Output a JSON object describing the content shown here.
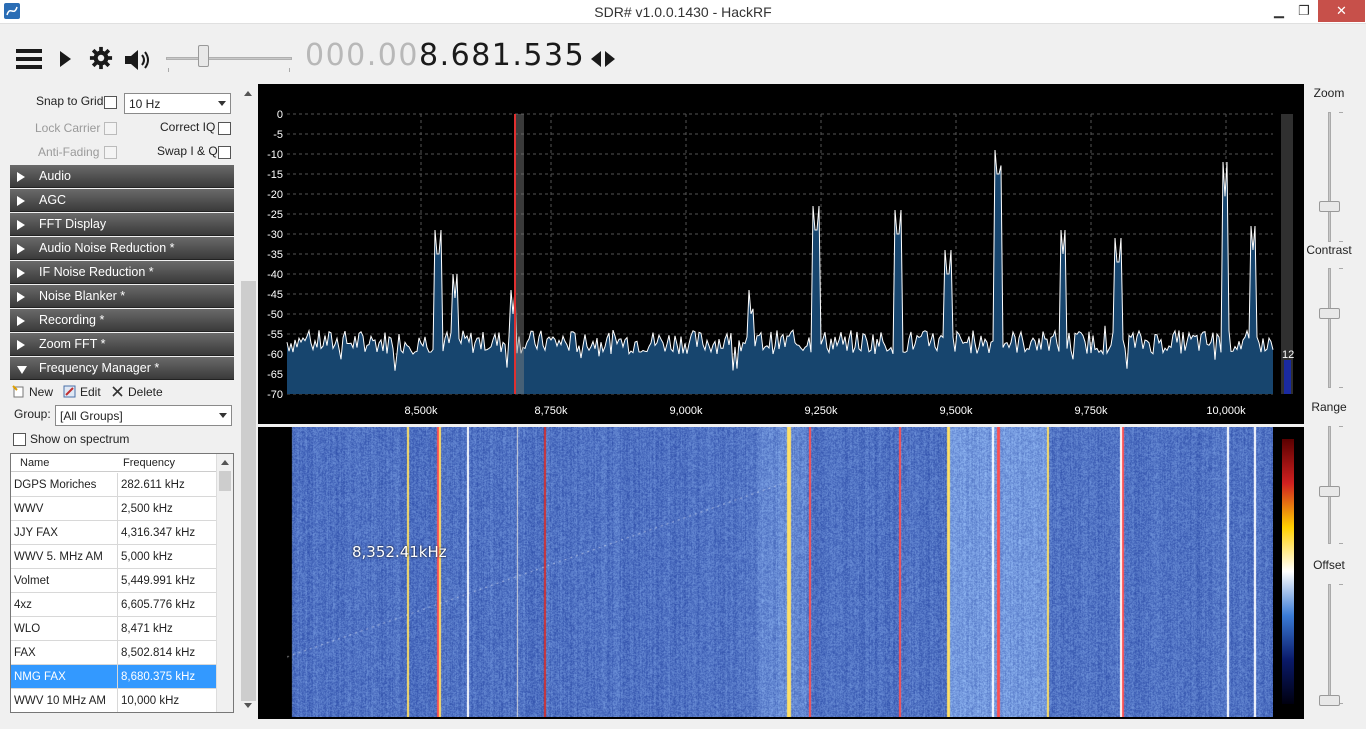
{
  "window": {
    "title": "SDR# v1.0.0.1430 - HackRF",
    "minimize": "▁",
    "maximize": "❐",
    "close": "✕"
  },
  "toolbar": {
    "menu_icon": "hamburger-icon",
    "play_icon": "play-icon",
    "settings_icon": "gear-icon",
    "volume_icon": "speaker-icon",
    "volume_level": 0.28,
    "frequency_dim": "000.00",
    "frequency_bright": "8.681.535",
    "tuning_icon": "left-right-arrows-icon"
  },
  "controls": {
    "snap_to_grid": "Snap to Grid",
    "snap_step": "10 Hz",
    "lock_carrier": "Lock Carrier",
    "correct_iq": "Correct IQ",
    "anti_fading": "Anti-Fading",
    "swap_iq": "Swap I & Q"
  },
  "sections": [
    "Audio",
    "AGC",
    "FFT Display",
    "Audio Noise Reduction *",
    "IF Noise Reduction *",
    "Noise Blanker *",
    "Recording *",
    "Zoom FFT *",
    "Frequency Manager *"
  ],
  "freq_manager": {
    "new": "New",
    "edit": "Edit",
    "delete": "Delete",
    "group_label": "Group:",
    "group_value": "[All Groups]",
    "show_on_spectrum": "Show on spectrum",
    "col_name": "Name",
    "col_freq": "Frequency",
    "rows": [
      {
        "name": "DGPS Moriches",
        "freq": "282.611 kHz"
      },
      {
        "name": "WWV",
        "freq": "2,500 kHz"
      },
      {
        "name": "JJY FAX",
        "freq": "4,316.347 kHz"
      },
      {
        "name": "WWV 5. MHz AM",
        "freq": "5,000 kHz"
      },
      {
        "name": "Volmet",
        "freq": "5,449.991 kHz"
      },
      {
        "name": "4xz",
        "freq": "6,605.776 kHz"
      },
      {
        "name": "WLO",
        "freq": "8,471 kHz"
      },
      {
        "name": "FAX",
        "freq": "8,502.814 kHz"
      },
      {
        "name": "NMG FAX",
        "freq": "8,680.375 kHz"
      },
      {
        "name": "WWV 10 MHz AM",
        "freq": "10,000 kHz"
      }
    ],
    "selected_index": 8
  },
  "spectrum": {
    "y_ticks": [
      "0",
      "-5",
      "-10",
      "-15",
      "-20",
      "-25",
      "-30",
      "-35",
      "-40",
      "-45",
      "-50",
      "-55",
      "-60",
      "-65",
      "-70"
    ],
    "x_ticks": [
      "8,500k",
      "8,750k",
      "9,000k",
      "9,250k",
      "9,500k",
      "9,750k",
      "10,000k"
    ],
    "level_readout": "12"
  },
  "waterfall": {
    "cursor_label": "8,352.41kHz"
  },
  "right_panel": {
    "zoom": "Zoom",
    "contrast": "Contrast",
    "range": "Range",
    "offset": "Offset"
  },
  "colors": {
    "spectrum_fill": "#17456e",
    "trace": "#ffffff",
    "section_bg": "#4a4a4a",
    "selection": "#3399ff"
  }
}
